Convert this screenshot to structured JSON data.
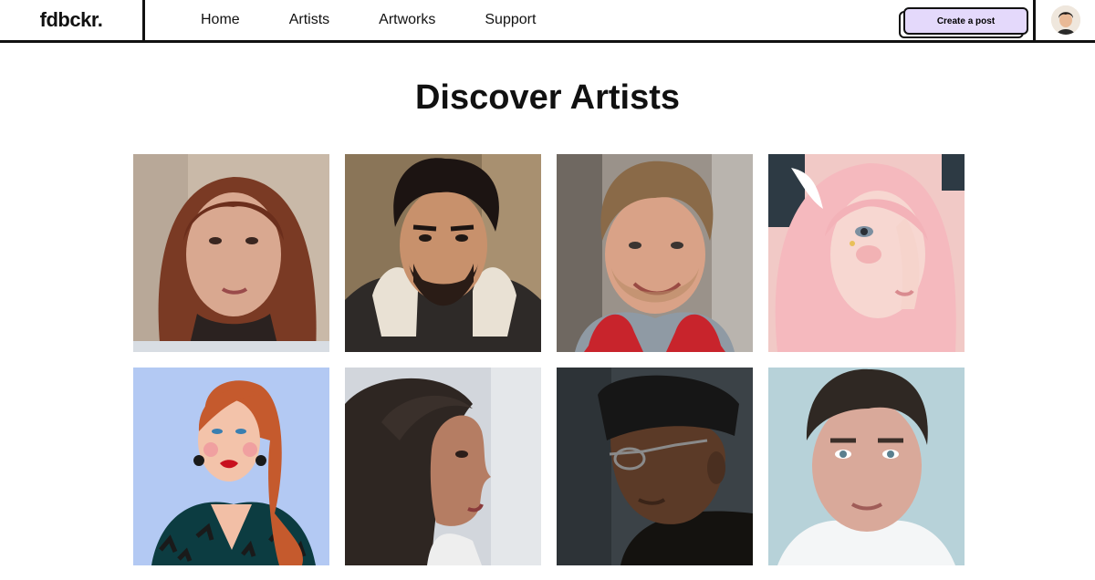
{
  "header": {
    "logo": "fdbckr.",
    "nav": [
      "Home",
      "Artists",
      "Artworks",
      "Support"
    ],
    "cta_label": "Create a post",
    "accent_color": "#e4d9fb"
  },
  "main": {
    "title": "Discover Artists"
  },
  "artists": [
    {
      "icon": "portrait-curly-red-hair-woman"
    },
    {
      "icon": "portrait-bearded-man"
    },
    {
      "icon": "portrait-smiling-man"
    },
    {
      "icon": "portrait-pink-hair-illustration"
    },
    {
      "icon": "portrait-red-hair-illustration"
    },
    {
      "icon": "portrait-dark-hair-woman-profile"
    },
    {
      "icon": "portrait-man-beanie-glasses"
    },
    {
      "icon": "portrait-young-man"
    }
  ]
}
